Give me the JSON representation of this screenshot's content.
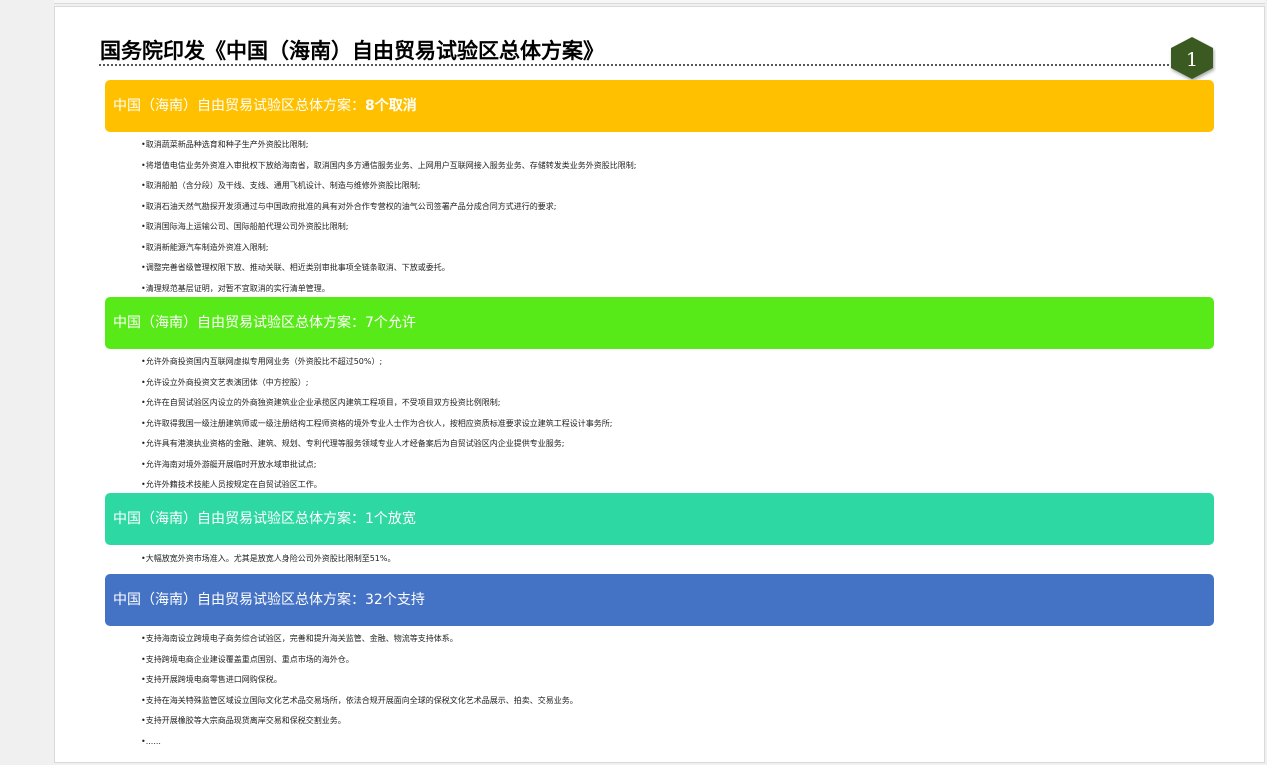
{
  "document": {
    "title": "国务院印发《中国（海南）自由贸易试验区总体方案》",
    "page_number": "1"
  },
  "colors": {
    "section1": "#ffc000",
    "section2": "#58ea18",
    "section3": "#2ed8a3",
    "section4": "#4472c4",
    "badge": "#3a5a20"
  },
  "sections": [
    {
      "prefix": "中国（海南）自由贸易试验区总体方案：",
      "highlight": "8个取消",
      "items": [
        "•取消蔬菜新品种选育和种子生产外资股比限制;",
        "•将增值电信业务外资准入审批权下放给海南省，取消国内多方通信服务业务、上网用户互联网接入服务业务、存储转发类业务外资股比限制;",
        "•取消船舶（含分段）及干线、支线、通用飞机设计、制造与维修外资股比限制;",
        "•取消石油天然气勘探开发须通过与中国政府批准的具有对外合作专营权的油气公司签署产品分成合同方式进行的要求;",
        "•取消国际海上运输公司、国际船舶代理公司外资股比限制;",
        "•取消新能源汽车制造外资准入限制;",
        "•调整完善省级管理权限下放、推动关联、相近类别审批事项全链条取消、下放或委托。",
        "•清理规范基层证明，对暂不宜取消的实行清单管理。"
      ]
    },
    {
      "prefix": "中国（海南）自由贸易试验区总体方案：",
      "highlight": "7个允许",
      "items": [
        "•允许外商投资国内互联网虚拟专用网业务（外资股比不超过50%）;",
        "•允许设立外商投资文艺表演团体（中方控股）;",
        "•允许在自贸试验区内设立的外商独资建筑业企业承揽区内建筑工程项目，不受项目双方投资比例限制;",
        "•允许取得我国一级注册建筑师或一级注册结构工程师资格的境外专业人士作为合伙人，按相应资质标准要求设立建筑工程设计事务所;",
        "•允许具有港澳执业资格的金融、建筑、规划、专利代理等服务领域专业人才经备案后为自贸试验区内企业提供专业服务;",
        "•允许海南对境外游艇开展临时开放水域审批试点;",
        "•允许外籍技术技能人员按规定在自贸试验区工作。"
      ]
    },
    {
      "prefix": "中国（海南）自由贸易试验区总体方案：",
      "highlight": "1个放宽",
      "items": [
        "•大幅放宽外资市场准入。尤其是放宽人身险公司外资股比限制至51%。"
      ]
    },
    {
      "prefix": "中国（海南）自由贸易试验区总体方案：",
      "highlight": "32个支持",
      "items": [
        "•支持海南设立跨境电子商务综合试验区，完善和提升海关监管、金融、物流等支持体系。",
        "•支持跨境电商企业建设覆盖重点国别、重点市场的海外仓。",
        "•支持开展跨境电商零售进口网购保税。",
        "•支持在海关特殊监管区域设立国际文化艺术品交易场所，依法合规开展面向全球的保税文化艺术品展示、拍卖、交易业务。",
        "•支持开展橡胶等大宗商品现货离岸交易和保税交割业务。",
        "•......"
      ]
    }
  ]
}
